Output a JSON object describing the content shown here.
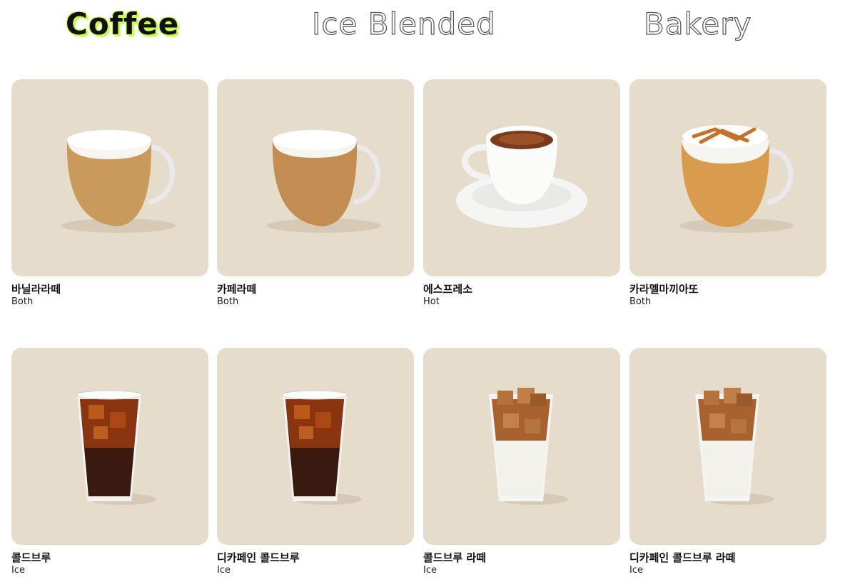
{
  "tabs": [
    {
      "label": "Coffee",
      "active": true
    },
    {
      "label": "Ice Blended",
      "active": false
    },
    {
      "label": "Bakery",
      "active": false
    }
  ],
  "colors": {
    "card_bg": "#e6dccb",
    "active_tab_glow": "#c8ff3a"
  },
  "products": [
    {
      "name": "바닐라라떼",
      "temp": "Both",
      "icon": "latte-mug-icon"
    },
    {
      "name": "카페라떼",
      "temp": "Both",
      "icon": "latte-mug-icon"
    },
    {
      "name": "에스프레소",
      "temp": "Hot",
      "icon": "espresso-cup-icon"
    },
    {
      "name": "카라멜마끼아또",
      "temp": "Both",
      "icon": "caramel-macchiato-mug-icon"
    },
    {
      "name": "콜드브루",
      "temp": "Ice",
      "icon": "iced-cold-brew-glass-icon"
    },
    {
      "name": "디카페인 콜드브루",
      "temp": "Ice",
      "icon": "iced-cold-brew-glass-icon"
    },
    {
      "name": "콜드브루 라떼",
      "temp": "Ice",
      "icon": "iced-cold-brew-latte-glass-icon"
    },
    {
      "name": "디카페인 콜드브루 라떼",
      "temp": "Ice",
      "icon": "iced-cold-brew-latte-glass-icon"
    }
  ]
}
